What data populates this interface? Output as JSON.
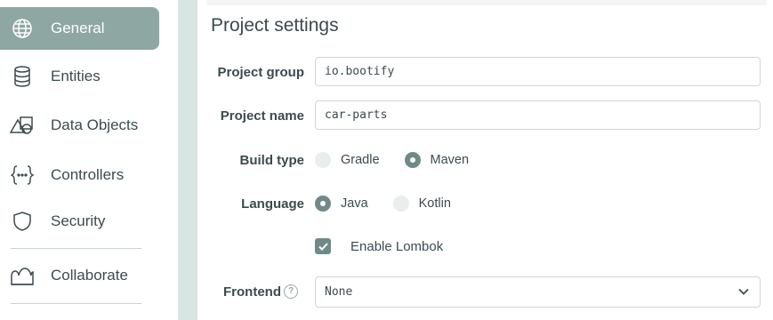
{
  "sidebar": {
    "items": [
      {
        "label": "General",
        "icon": "globe-icon",
        "active": true
      },
      {
        "label": "Entities",
        "icon": "database-icon",
        "active": false
      },
      {
        "label": "Data Objects",
        "icon": "shapes-icon",
        "active": false
      },
      {
        "label": "Controllers",
        "icon": "braces-icon",
        "active": false
      },
      {
        "label": "Security",
        "icon": "shield-icon",
        "active": false
      },
      {
        "label": "Collaborate",
        "icon": "people-icon",
        "active": false
      }
    ]
  },
  "main": {
    "title": "Project settings",
    "project_group": {
      "label": "Project group",
      "value": "io.bootify"
    },
    "project_name": {
      "label": "Project name",
      "value": "car-parts"
    },
    "build_type": {
      "label": "Build type",
      "options": [
        "Gradle",
        "Maven"
      ],
      "selected": "Maven"
    },
    "language": {
      "label": "Language",
      "options": [
        "Java",
        "Kotlin"
      ],
      "selected": "Java"
    },
    "lombok": {
      "label": "Enable Lombok",
      "checked": true
    },
    "frontend": {
      "label": "Frontend",
      "value": "None",
      "help_icon": "question-icon"
    }
  },
  "colors": {
    "accent": "#8ea7a3",
    "accent_dark": "#6f8a87",
    "gutter": "#d8e6e3"
  }
}
